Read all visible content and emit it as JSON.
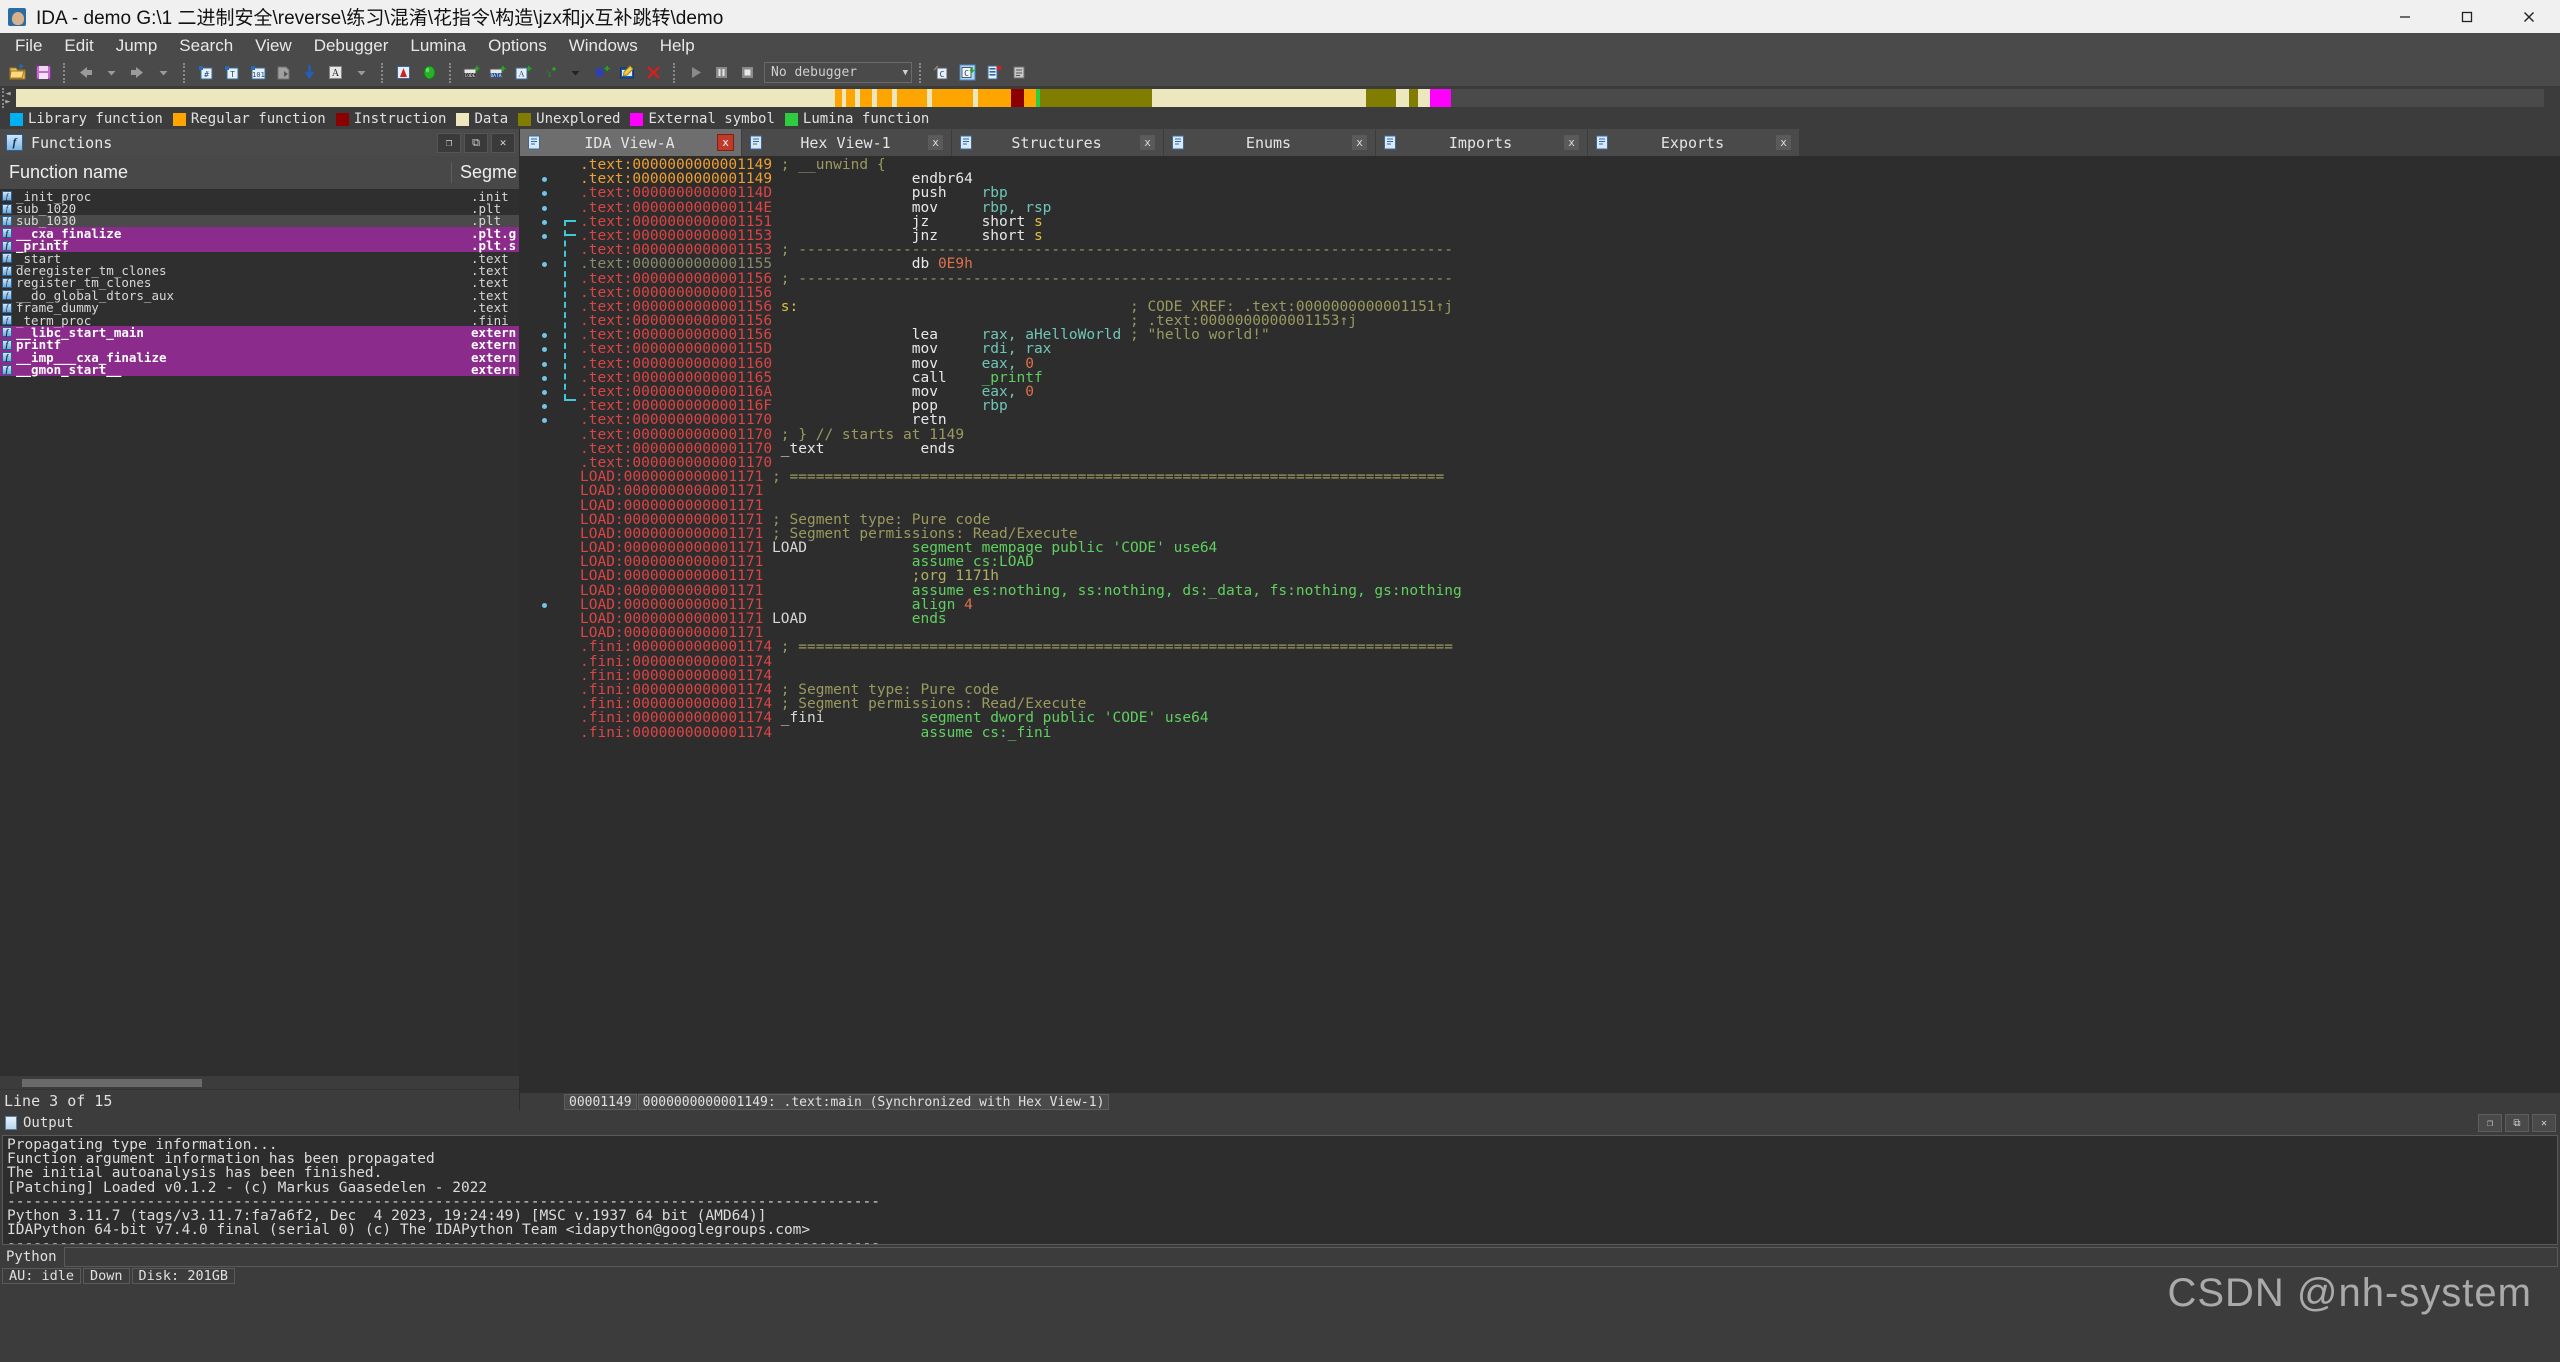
{
  "window": {
    "title": "IDA - demo G:\\1 二进制安全\\reverse\\练习\\混淆\\花指令\\构造\\jzx和jx互补跳转\\demo",
    "minimize": "–",
    "maximize": "□",
    "close": "✕"
  },
  "menubar": [
    {
      "label": "File"
    },
    {
      "label": "Edit"
    },
    {
      "label": "Jump"
    },
    {
      "label": "Search"
    },
    {
      "label": "View"
    },
    {
      "label": "Debugger"
    },
    {
      "label": "Lumina"
    },
    {
      "label": "Options"
    },
    {
      "label": "Windows"
    },
    {
      "label": "Help"
    }
  ],
  "toolbar": {
    "debugger_select": "No debugger",
    "dropdown_arrow": "▼",
    "icons": [
      "open-file-icon",
      "save-icon",
      "back-icon",
      "back-dropdown-icon",
      "forward-icon",
      "forward-dropdown-icon",
      "jump-to-address-icon",
      "jump-to-name-icon",
      "jump-to-number-icon",
      "search-next-icon",
      "jump-down-icon",
      "text-search-icon",
      "text-search-dropdown-icon",
      "graph-view-icon",
      "lumina-status-icon",
      "make-code-icon",
      "make-data-icon",
      "make-ascii-icon",
      "make-struct-icon",
      "struct-dropdown-icon",
      "make-unexplored-icon",
      "edit-function-icon",
      "delete-icon",
      "run-icon",
      "pause-icon",
      "stop-icon"
    ]
  },
  "legend": [
    {
      "label": "Library function",
      "color": "#00b0f0"
    },
    {
      "label": "Regular function",
      "color": "#ffa500"
    },
    {
      "label": "Instruction",
      "color": "#8b0000"
    },
    {
      "label": "Data",
      "color": "#ece7bd"
    },
    {
      "label": "Unexplored",
      "color": "#807d00"
    },
    {
      "label": "External symbol",
      "color": "#ff00ff"
    },
    {
      "label": "Lumina function",
      "color": "#2ecc40"
    }
  ],
  "navband": [
    {
      "color": "#ece7bd",
      "width": 32.2
    },
    {
      "color": "#ffa500",
      "width": 0.28
    },
    {
      "color": "#ece7bd",
      "width": 0.18
    },
    {
      "color": "#ffa500",
      "width": 0.35
    },
    {
      "color": "#ece7bd",
      "width": 0.18
    },
    {
      "color": "#ffa500",
      "width": 0.5
    },
    {
      "color": "#ece7bd",
      "width": 0.18
    },
    {
      "color": "#ffa500",
      "width": 0.6
    },
    {
      "color": "#ece7bd",
      "width": 0.18
    },
    {
      "color": "#ffa500",
      "width": 1.2
    },
    {
      "color": "#ece7bd",
      "width": 0.2
    },
    {
      "color": "#ffa500",
      "width": 1.6
    },
    {
      "color": "#ece7bd",
      "width": 0.2
    },
    {
      "color": "#ffa500",
      "width": 1.3
    },
    {
      "color": "#8b0000",
      "width": 0.5
    },
    {
      "color": "#ffa500",
      "width": 0.5
    },
    {
      "color": "#2ecc40",
      "width": 0.15
    },
    {
      "color": "#807d00",
      "width": 4.4
    },
    {
      "color": "#ece7bd",
      "width": 8.4
    },
    {
      "color": "#807d00",
      "width": 1.2
    },
    {
      "color": "#ece7bd",
      "width": 0.5
    },
    {
      "color": "#807d00",
      "width": 0.35
    },
    {
      "color": "#ece7bd",
      "width": 0.5
    },
    {
      "color": "#ff00ff",
      "width": 0.8
    },
    {
      "color": "#4a4a4a",
      "width": 43.0
    }
  ],
  "functions_panel": {
    "title": "Functions",
    "buttons": [
      "restore-icon",
      "maximize-icon",
      "close-icon"
    ],
    "columns": [
      "Function name",
      "Segme"
    ],
    "rows": [
      {
        "name": "_init_proc",
        "segment": ".init",
        "style": "normal"
      },
      {
        "name": "sub_1020",
        "segment": ".plt",
        "style": "normal"
      },
      {
        "name": "sub_1030",
        "segment": ".plt",
        "style": "selected"
      },
      {
        "name": "__cxa_finalize",
        "segment": ".plt.g",
        "style": "pink"
      },
      {
        "name": "_printf",
        "segment": ".plt.s",
        "style": "pink"
      },
      {
        "name": "_start",
        "segment": ".text",
        "style": "normal"
      },
      {
        "name": "deregister_tm_clones",
        "segment": ".text",
        "style": "normal"
      },
      {
        "name": "register_tm_clones",
        "segment": ".text",
        "style": "normal"
      },
      {
        "name": "__do_global_dtors_aux",
        "segment": ".text",
        "style": "normal"
      },
      {
        "name": "frame_dummy",
        "segment": ".text",
        "style": "normal"
      },
      {
        "name": "_term_proc",
        "segment": ".fini",
        "style": "normal"
      },
      {
        "name": "__libc_start_main",
        "segment": "extern",
        "style": "pink"
      },
      {
        "name": "printf",
        "segment": "extern",
        "style": "pink"
      },
      {
        "name": "__imp___cxa_finalize",
        "segment": "extern",
        "style": "pink"
      },
      {
        "name": "__gmon_start__",
        "segment": "extern",
        "style": "pink"
      }
    ],
    "status": "Line 3 of 15"
  },
  "tabs": [
    {
      "label": "IDA View-A",
      "icon": "ida-view-icon",
      "active": true,
      "close": "x"
    },
    {
      "label": "Hex View-1",
      "icon": "hex-view-icon",
      "active": false,
      "close": "x"
    },
    {
      "label": "Structures",
      "icon": "structures-icon",
      "active": false,
      "close": "x"
    },
    {
      "label": "Enums",
      "icon": "enums-icon",
      "active": false,
      "close": "x"
    },
    {
      "label": "Imports",
      "icon": "imports-icon",
      "active": false,
      "close": "x"
    },
    {
      "label": "Exports",
      "icon": "exports-icon",
      "active": false,
      "close": "x"
    }
  ],
  "disassembly": {
    "lines": [
      {
        "dot": false,
        "addr": ".text:0000000000001149",
        "addr_style": "hl",
        "segs": [
          {
            "t": " ; __unwind {",
            "c": "cmt"
          }
        ]
      },
      {
        "dot": true,
        "addr": ".text:0000000000001149",
        "addr_style": "hl",
        "segs": [
          {
            "t": "                endbr64",
            "c": "kw"
          }
        ]
      },
      {
        "dot": true,
        "addr": ".text:000000000000114D",
        "addr_style": "n",
        "segs": [
          {
            "t": "                push    ",
            "c": "kw"
          },
          {
            "t": "rbp",
            "c": "reg"
          }
        ]
      },
      {
        "dot": true,
        "addr": ".text:000000000000114E",
        "addr_style": "n",
        "segs": [
          {
            "t": "                mov     ",
            "c": "kw"
          },
          {
            "t": "rbp, rsp",
            "c": "reg"
          }
        ]
      },
      {
        "dot": true,
        "addr": ".text:0000000000001151",
        "addr_style": "n",
        "segs": [
          {
            "t": "                jz      ",
            "c": "kw"
          },
          {
            "t": "short ",
            "c": "kw"
          },
          {
            "t": "s",
            "c": "lbl"
          }
        ]
      },
      {
        "dot": true,
        "addr": ".text:0000000000001153",
        "addr_style": "n",
        "segs": [
          {
            "t": "                jnz     ",
            "c": "kw"
          },
          {
            "t": "short ",
            "c": "kw"
          },
          {
            "t": "s",
            "c": "lbl"
          }
        ]
      },
      {
        "dot": false,
        "addr": ".text:0000000000001153",
        "addr_style": "n",
        "segs": [
          {
            "t": " ; ---------------------------------------------------------------------------",
            "c": "cmt"
          }
        ]
      },
      {
        "dot": true,
        "addr": ".text:0000000000001155",
        "addr_style": "dim",
        "segs": [
          {
            "t": "                db ",
            "c": "kw"
          },
          {
            "t": "0E9h",
            "c": "num"
          }
        ]
      },
      {
        "dot": false,
        "addr": ".text:0000000000001156",
        "addr_style": "n",
        "segs": [
          {
            "t": " ; ---------------------------------------------------------------------------",
            "c": "cmt"
          }
        ]
      },
      {
        "dot": false,
        "addr": ".text:0000000000001156",
        "addr_style": "n",
        "segs": []
      },
      {
        "dot": false,
        "addr": ".text:0000000000001156",
        "addr_style": "n",
        "segs": [
          {
            "t": " s:",
            "c": "lbl"
          },
          {
            "t": "                                      ; CODE XREF: .text:0000000000001151↑j",
            "c": "xref"
          }
        ]
      },
      {
        "dot": false,
        "addr": ".text:0000000000001156",
        "addr_style": "n",
        "segs": [
          {
            "t": "                                         ; .text:0000000000001153↑j",
            "c": "xref"
          }
        ]
      },
      {
        "dot": true,
        "addr": ".text:0000000000001156",
        "addr_style": "n",
        "segs": [
          {
            "t": "                lea     ",
            "c": "kw"
          },
          {
            "t": "rax, aHelloWorld",
            "c": "reg"
          },
          {
            "t": " ; \"hello world!\"",
            "c": "cmt"
          }
        ]
      },
      {
        "dot": true,
        "addr": ".text:000000000000115D",
        "addr_style": "n",
        "segs": [
          {
            "t": "                mov     ",
            "c": "kw"
          },
          {
            "t": "rdi, rax",
            "c": "reg"
          }
        ]
      },
      {
        "dot": true,
        "addr": ".text:0000000000001160",
        "addr_style": "n",
        "segs": [
          {
            "t": "                mov     ",
            "c": "kw"
          },
          {
            "t": "eax, ",
            "c": "reg"
          },
          {
            "t": "0",
            "c": "num"
          }
        ]
      },
      {
        "dot": true,
        "addr": ".text:0000000000001165",
        "addr_style": "n",
        "segs": [
          {
            "t": "                call    ",
            "c": "kw"
          },
          {
            "t": "_printf",
            "c": "seg"
          }
        ]
      },
      {
        "dot": true,
        "addr": ".text:000000000000116A",
        "addr_style": "n",
        "segs": [
          {
            "t": "                mov     ",
            "c": "kw"
          },
          {
            "t": "eax, ",
            "c": "reg"
          },
          {
            "t": "0",
            "c": "num"
          }
        ]
      },
      {
        "dot": true,
        "addr": ".text:000000000000116F",
        "addr_style": "n",
        "segs": [
          {
            "t": "                pop     ",
            "c": "kw"
          },
          {
            "t": "rbp",
            "c": "reg"
          }
        ]
      },
      {
        "dot": true,
        "addr": ".text:0000000000001170",
        "addr_style": "n",
        "segs": [
          {
            "t": "                retn",
            "c": "kw"
          }
        ]
      },
      {
        "dot": false,
        "addr": ".text:0000000000001170",
        "addr_style": "n",
        "segs": [
          {
            "t": " ; } // starts at 1149",
            "c": "cmt"
          }
        ]
      },
      {
        "dot": false,
        "addr": ".text:0000000000001170",
        "addr_style": "n",
        "segs": [
          {
            "t": " _text           ends",
            "c": "kw"
          }
        ]
      },
      {
        "dot": false,
        "addr": ".text:0000000000001170",
        "addr_style": "n",
        "segs": []
      },
      {
        "dot": false,
        "addr": "LOAD:0000000000001171",
        "addr_style": "p",
        "segs": [
          {
            "t": " ; ===========================================================================",
            "c": "cmt"
          }
        ]
      },
      {
        "dot": false,
        "addr": "LOAD:0000000000001171",
        "addr_style": "p",
        "segs": []
      },
      {
        "dot": false,
        "addr": "LOAD:0000000000001171",
        "addr_style": "p",
        "segs": []
      },
      {
        "dot": false,
        "addr": "LOAD:0000000000001171",
        "addr_style": "p",
        "segs": [
          {
            "t": " ; Segment type: Pure code",
            "c": "cmt"
          }
        ]
      },
      {
        "dot": false,
        "addr": "LOAD:0000000000001171",
        "addr_style": "p",
        "segs": [
          {
            "t": " ; Segment permissions: Read/Execute",
            "c": "cmt"
          }
        ]
      },
      {
        "dot": false,
        "addr": "LOAD:0000000000001171",
        "addr_style": "p",
        "segs": [
          {
            "t": " LOAD            ",
            "c": "plain"
          },
          {
            "t": "segment mempage public 'CODE' use64",
            "c": "seg"
          }
        ]
      },
      {
        "dot": false,
        "addr": "LOAD:0000000000001171",
        "addr_style": "p",
        "segs": [
          {
            "t": "                 ",
            "c": "plain"
          },
          {
            "t": "assume cs:LOAD",
            "c": "seg"
          }
        ]
      },
      {
        "dot": false,
        "addr": "LOAD:0000000000001171",
        "addr_style": "p",
        "segs": [
          {
            "t": "                 ",
            "c": "plain"
          },
          {
            "t": ";org 1171h",
            "c": "cmt2"
          }
        ]
      },
      {
        "dot": false,
        "addr": "LOAD:0000000000001171",
        "addr_style": "p",
        "segs": [
          {
            "t": "                 ",
            "c": "plain"
          },
          {
            "t": "assume es:nothing, ss:nothing, ds:_data, fs:nothing, gs:nothing",
            "c": "seg"
          }
        ]
      },
      {
        "dot": true,
        "addr": "LOAD:0000000000001171",
        "addr_style": "p",
        "segs": [
          {
            "t": "                 ",
            "c": "plain"
          },
          {
            "t": "align ",
            "c": "seg"
          },
          {
            "t": "4",
            "c": "num"
          }
        ]
      },
      {
        "dot": false,
        "addr": "LOAD:0000000000001171",
        "addr_style": "p",
        "segs": [
          {
            "t": " LOAD            ",
            "c": "plain"
          },
          {
            "t": "ends",
            "c": "seg"
          }
        ]
      },
      {
        "dot": false,
        "addr": "LOAD:0000000000001171",
        "addr_style": "p",
        "segs": []
      },
      {
        "dot": false,
        "addr": ".fini:0000000000001174",
        "addr_style": "n",
        "segs": [
          {
            "t": " ; ===========================================================================",
            "c": "cmt"
          }
        ]
      },
      {
        "dot": false,
        "addr": ".fini:0000000000001174",
        "addr_style": "n",
        "segs": []
      },
      {
        "dot": false,
        "addr": ".fini:0000000000001174",
        "addr_style": "n",
        "segs": []
      },
      {
        "dot": false,
        "addr": ".fini:0000000000001174",
        "addr_style": "n",
        "segs": [
          {
            "t": " ; Segment type: Pure code",
            "c": "cmt"
          }
        ]
      },
      {
        "dot": false,
        "addr": ".fini:0000000000001174",
        "addr_style": "n",
        "segs": [
          {
            "t": " ; Segment permissions: Read/Execute",
            "c": "cmt"
          }
        ]
      },
      {
        "dot": false,
        "addr": ".fini:0000000000001174",
        "addr_style": "n",
        "segs": [
          {
            "t": " _fini           ",
            "c": "plain"
          },
          {
            "t": "segment dword public 'CODE' use64",
            "c": "seg"
          }
        ]
      },
      {
        "dot": false,
        "addr": ".fini:0000000000001174",
        "addr_style": "n",
        "segs": [
          {
            "t": "                 ",
            "c": "plain"
          },
          {
            "t": "assume cs:_fini",
            "c": "seg"
          }
        ]
      }
    ],
    "status_cells": [
      "00001149",
      "0000000000001149: .text:main (Synchronized with Hex View-1)"
    ]
  },
  "output": {
    "title": "Output",
    "buttons": [
      "restore-icon",
      "maximize-icon",
      "close-icon"
    ],
    "lines": [
      "Propagating type information...",
      "Function argument information has been propagated",
      "The initial autoanalysis has been finished.",
      "[Patching] Loaded v0.1.2 - (c) Markus Gaasedelen - 2022",
      "----------------------------------------------------------------------------------------------------",
      "Python 3.11.7 (tags/v3.11.7:fa7a6f2, Dec  4 2023, 19:24:49) [MSC v.1937 64 bit (AMD64)]",
      "IDAPython 64-bit v7.4.0 final (serial 0) (c) The IDAPython Team <idapython@googlegroups.com>",
      "----------------------------------------------------------------------------------------------------"
    ],
    "cli_label": "Python",
    "cli_value": ""
  },
  "statusbar": [
    {
      "label": "AU: idle"
    },
    {
      "label": "Down"
    },
    {
      "label": "Disk: 201GB"
    }
  ],
  "watermark": "CSDN @nh-system"
}
